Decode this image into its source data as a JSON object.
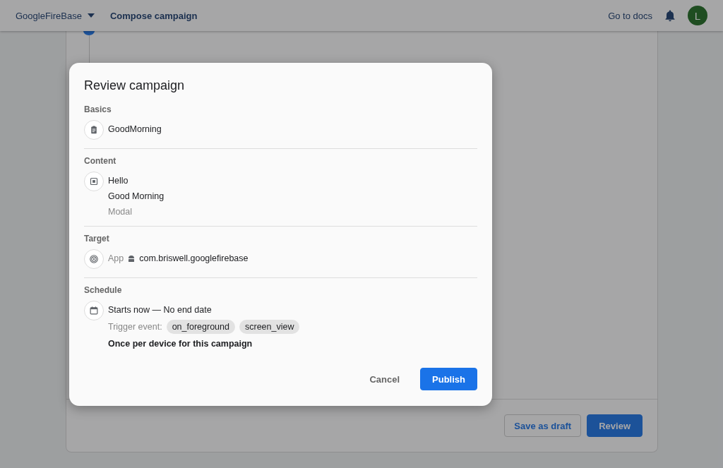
{
  "header": {
    "project": "GoogleFireBase",
    "page_title": "Compose campaign",
    "docs_link": "Go to docs",
    "avatar_letter": "L"
  },
  "dialog": {
    "title": "Review campaign",
    "sections": [
      {
        "heading": "Basics",
        "kind": "clipboard",
        "lines": [
          {
            "kind": "text",
            "text": "GoodMorning"
          }
        ]
      },
      {
        "heading": "Content",
        "kind": "square",
        "lines": [
          {
            "kind": "text",
            "text": "Hello"
          },
          {
            "kind": "text",
            "text": "Good Morning"
          },
          {
            "kind": "muted",
            "text": "Modal"
          }
        ]
      },
      {
        "heading": "Target",
        "kind": "target",
        "lines": [
          {
            "kind": "app",
            "label": "App",
            "text": "com.briswell.googlefirebase"
          }
        ]
      },
      {
        "heading": "Schedule",
        "kind": "calendar",
        "lines": [
          {
            "kind": "text",
            "text": "Starts now — No end date"
          },
          {
            "kind": "chips",
            "label": "Trigger event:",
            "chips": [
              "on_foreground",
              "screen_view"
            ]
          },
          {
            "kind": "bold",
            "text": "Once per device for this campaign"
          }
        ]
      }
    ],
    "buttons": [
      {
        "kind": "text",
        "label": "Cancel"
      },
      {
        "kind": "primary",
        "label": "Publish"
      }
    ]
  },
  "footer": {
    "buttons": [
      {
        "kind": "outlined",
        "label": "Save as draft"
      },
      {
        "kind": "primary",
        "label": "Review"
      }
    ]
  }
}
